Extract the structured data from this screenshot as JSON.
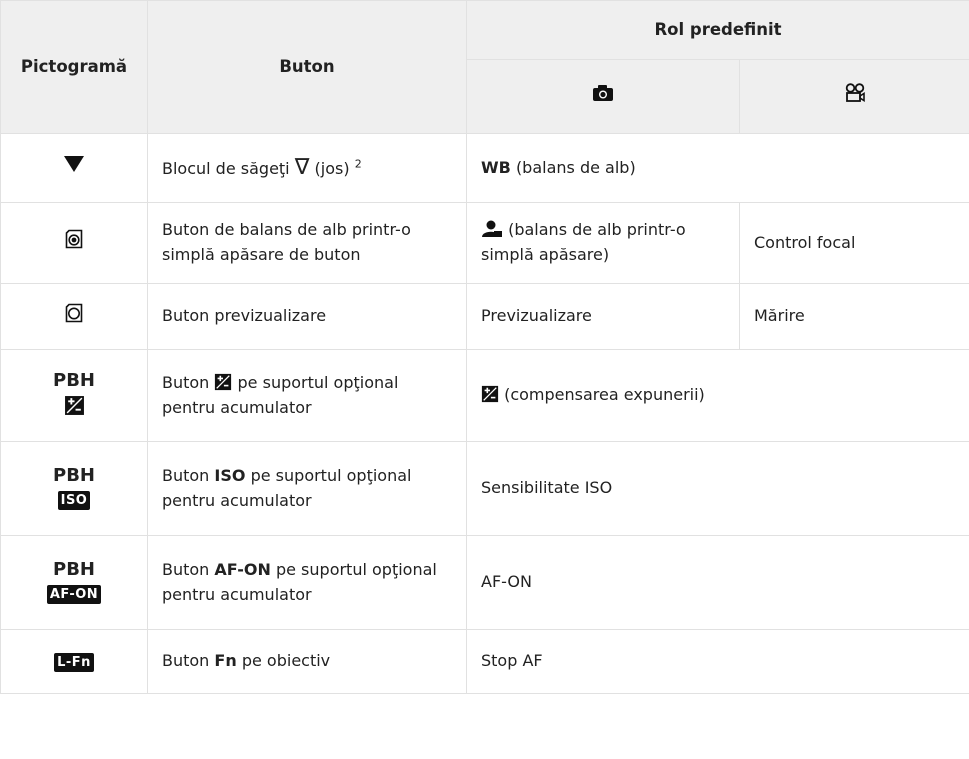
{
  "headers": {
    "icon": "Pictogramă",
    "button": "Buton",
    "role": "Rol predefinit"
  },
  "rows": {
    "r1": {
      "button_text": "Blocul de săgeţi",
      "button_symbol": "∇",
      "button_tail": "(jos)",
      "button_sup": "2",
      "role_bold": "WB",
      "role_text": "(balans de alb)"
    },
    "r2": {
      "button_text": "Buton de balans de alb printr-o simplă apăsare de buton",
      "role_photo_text": "(balans de alb printr-o simplă apăsare)",
      "role_movie": "Control focal"
    },
    "r3": {
      "button_text": "Buton previzualizare",
      "role_photo": "Previzualizare",
      "role_movie": "Mărire"
    },
    "r4": {
      "pbh": "PBH",
      "button_a": "Buton",
      "button_b": "pe suportul opţional pentru acumulator",
      "role_text": "(compensarea expunerii)"
    },
    "r5": {
      "pbh": "PBH",
      "chip": "ISO",
      "button_a": "Buton",
      "button_bold": "ISO",
      "button_b": "pe suportul opţional pentru acumulator",
      "role": "Sensibilitate ISO"
    },
    "r6": {
      "pbh": "PBH",
      "chip": "AF-ON",
      "button_a": "Buton",
      "button_bold": "AF-ON",
      "button_b": "pe suportul opţional pentru acumulator",
      "role": "AF-ON"
    },
    "r7": {
      "chip": "L-Fn",
      "button_a": "Buton",
      "button_bold": "Fn",
      "button_b": "pe obiectiv",
      "role": "Stop AF"
    }
  }
}
